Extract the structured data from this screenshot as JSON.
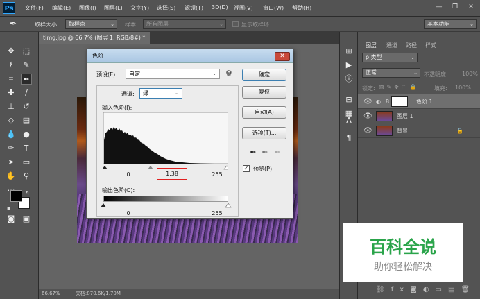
{
  "app": {
    "logo": "Ps"
  },
  "menu": [
    "文件(F)",
    "编辑(E)",
    "图像(I)",
    "图层(L)",
    "文字(Y)",
    "选择(S)",
    "滤镜(T)",
    "3D(D)",
    "视图(V)",
    "窗口(W)",
    "帮助(H)"
  ],
  "window_controls": {
    "minimize": "—",
    "restore": "❐",
    "close": "✕"
  },
  "options_bar": {
    "sample_size_label": "取样大小:",
    "sample_size_value": "取样点",
    "sample_label": "样本:",
    "sample_value": "所有图层",
    "show_ring_label": "显示取样环",
    "workspace": "基本功能"
  },
  "document": {
    "tab_title": "timg.jpg @ 66.7% (图层 1, RGB/8#) *",
    "tab_close": "×",
    "zoom": "66.67%",
    "doc_size": "文档:870.6K/1.70M"
  },
  "panels": {
    "tabs": [
      "图层",
      "通道",
      "路径",
      "样式"
    ],
    "kind_filter": "ρ 类型",
    "blend_mode": "正常",
    "opacity_label": "不透明度:",
    "opacity_value": "100%",
    "lock_label": "锁定:",
    "fill_label": "填充:",
    "fill_value": "100%",
    "layers": [
      {
        "name": "色阶 1",
        "active": true
      },
      {
        "name": "图层 1",
        "active": false
      },
      {
        "name": "背景",
        "active": false
      }
    ]
  },
  "dialog": {
    "title": "色阶",
    "preset_label": "预设(E):",
    "preset_value": "自定",
    "channel_label": "通道:",
    "channel_value": "绿",
    "input_levels_label": "输入色阶(I):",
    "output_levels_label": "输出色阶(O):",
    "input_black": "0",
    "input_gamma": "1.38",
    "input_white": "255",
    "output_black": "0",
    "output_white": "255",
    "buttons": {
      "ok": "确定",
      "reset": "复位",
      "auto": "自动(A)",
      "options": "选项(T)..."
    },
    "preview_label": "预览(P)",
    "preview_checked": true
  },
  "watermark": {
    "line1": "百科全说",
    "line2": "助你轻松解决"
  },
  "colors": {
    "accent_highlight": "#e02020",
    "watermark_green": "#2aa44a"
  }
}
